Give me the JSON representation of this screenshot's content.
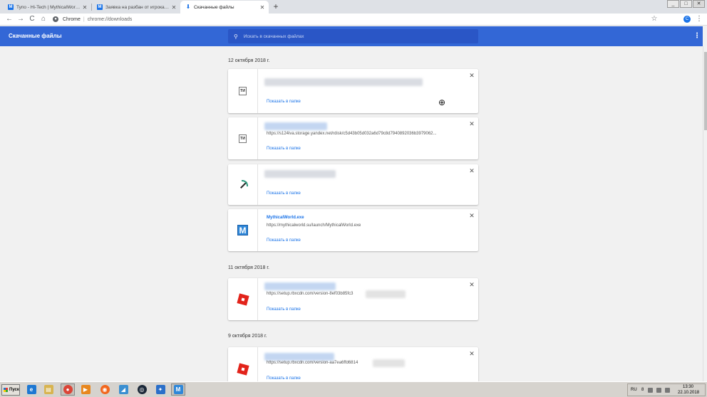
{
  "browser": {
    "tabs": [
      {
        "favicon": "M",
        "title": "Тупо - Hi-Tech | MythicalWorld - Фо"
      },
      {
        "favicon": "M",
        "title": "Заявка на разбан от игрока Ig_So"
      },
      {
        "favicon": "download-icon",
        "title": "Скачанные файлы"
      }
    ],
    "tab_close_glyph": "✕",
    "new_tab_glyph": "+",
    "toolbar": {
      "back": "←",
      "forward": "→",
      "reload": "C",
      "home": "⌂",
      "scheme_label": "Chrome",
      "url": "chrome://downloads",
      "star": "☆",
      "avatar": "C",
      "menu": "⋮"
    },
    "window_controls": [
      "_",
      "□",
      "✕"
    ]
  },
  "downloads": {
    "title": "Скачанные файлы",
    "search_placeholder": "Искать в скачанных файлах",
    "menu_icon": "⋮",
    "groups": [
      {
        "date": "12 октября 2018 г.",
        "items": [
          {
            "icon": "document-icon",
            "icon_text": "ТИ",
            "file_name": "",
            "url": "",
            "action": "Показать в папке"
          },
          {
            "icon": "document-icon",
            "icon_text": "ТИ",
            "file_name": "",
            "url": "https://s124iva.storage.yandex.net/rdisk/c5d43b05d032a6d79c8d7940892036b3979062...",
            "action": "Показать в папке"
          },
          {
            "icon": "pickaxe-icon",
            "icon_text": "",
            "file_name": "",
            "url": "",
            "action": "Показать в папке"
          },
          {
            "icon": "mythicalworld-icon",
            "icon_text": "M",
            "file_name": "MythicalWorld.exe",
            "url": "https://mythicalworld.su/launch/MythicalWorld.exe",
            "action": "Показать в папке"
          }
        ]
      },
      {
        "date": "11 октября 2018 г.",
        "items": [
          {
            "icon": "roblox-icon",
            "icon_text": "",
            "file_name": "",
            "url": "https://setup.rbxcdn.com/version-8ef03b85fc3",
            "action": "Показать в папке"
          }
        ]
      },
      {
        "date": "9 октября 2018 г.",
        "items": [
          {
            "icon": "roblox-icon",
            "icon_text": "",
            "file_name": "",
            "url": "https://setup.rbxcdn.com/version-aa7ea6ffd6814",
            "action": "Показать в папке"
          }
        ]
      }
    ],
    "remove_glyph": "✕"
  },
  "taskbar": {
    "start_label": "Пуск",
    "apps": [
      {
        "name": "ie",
        "glyph": "e",
        "color": "#1e78d2"
      },
      {
        "name": "explorer",
        "glyph": "▤",
        "color": "#d8b450"
      },
      {
        "name": "chrome",
        "glyph": "●",
        "color": "#db4437"
      },
      {
        "name": "media",
        "glyph": "▶",
        "color": "#e8871e"
      },
      {
        "name": "origin",
        "glyph": "◉",
        "color": "#f2661c"
      },
      {
        "name": "app-blue",
        "glyph": "◢",
        "color": "#3b8fd1"
      },
      {
        "name": "steam",
        "glyph": "◎",
        "color": "#1b2838"
      },
      {
        "name": "sword",
        "glyph": "✦",
        "color": "#2b6fc9"
      },
      {
        "name": "mythicalworld",
        "glyph": "M",
        "color": "#2f87d8"
      }
    ],
    "tray": {
      "lang": "RU",
      "num": "8",
      "time": "13:30",
      "date": "22.10.2018"
    }
  },
  "colors": {
    "header_blue": "#3367d6",
    "link_blue": "#1a73e8",
    "roblox_red": "#e2231a"
  }
}
